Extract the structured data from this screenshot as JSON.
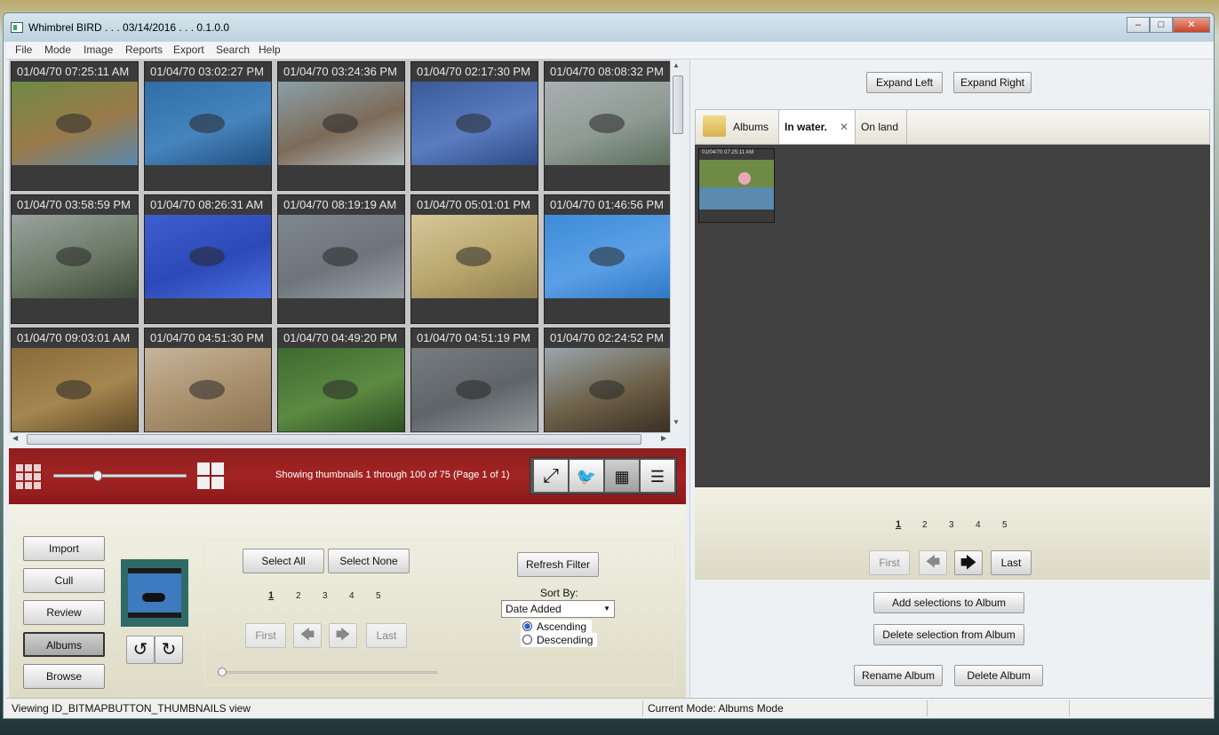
{
  "window": {
    "title": "Whimbrel BIRD . . . 03/14/2016 . . . 0.1.0.0"
  },
  "menu": [
    "File",
    "Mode",
    "Image",
    "Reports",
    "Export",
    "Search",
    "Help"
  ],
  "thumbnails": [
    {
      "ts": "01/04/70 07:25:11 AM",
      "colors": [
        "#6f8a45",
        "#9a7a4a",
        "#5a8ab0"
      ]
    },
    {
      "ts": "01/04/70 03:02:27 PM",
      "colors": [
        "#2f6ea8",
        "#4684bd",
        "#1f4f80"
      ]
    },
    {
      "ts": "01/04/70 03:24:36 PM",
      "colors": [
        "#8aa0a8",
        "#7c6a58",
        "#b8c0c2"
      ]
    },
    {
      "ts": "01/04/70 02:17:30 PM",
      "colors": [
        "#3a5a9a",
        "#5a7cbf",
        "#2e4a86"
      ]
    },
    {
      "ts": "01/04/70 08:08:32 PM",
      "colors": [
        "#a8b0b0",
        "#8e9a94",
        "#5b6e5a"
      ]
    },
    {
      "ts": "01/04/70 03:58:59 PM",
      "colors": [
        "#9aa3a0",
        "#6c7a66",
        "#3d4a3a"
      ]
    },
    {
      "ts": "01/04/70 08:26:31 AM",
      "colors": [
        "#3e5fd1",
        "#2c49b8",
        "#4a6ee0"
      ]
    },
    {
      "ts": "01/04/70 08:19:19 AM",
      "colors": [
        "#7f8790",
        "#6d747c",
        "#9ba2a8"
      ]
    },
    {
      "ts": "01/04/70 05:01:01 PM",
      "colors": [
        "#d6c79a",
        "#b9a66d",
        "#8f7f50"
      ]
    },
    {
      "ts": "01/04/70 01:46:56 PM",
      "colors": [
        "#3e8bd8",
        "#5aa0e6",
        "#2e78c6"
      ]
    },
    {
      "ts": "01/04/70 09:03:01 AM",
      "colors": [
        "#8a6a3a",
        "#a5864f",
        "#5f4a26"
      ]
    },
    {
      "ts": "01/04/70 04:51:30 PM",
      "colors": [
        "#c6b49a",
        "#a88f6c",
        "#8a7352"
      ]
    },
    {
      "ts": "01/04/70 04:49:20 PM",
      "colors": [
        "#3f6a30",
        "#5c8a42",
        "#2d4f22"
      ]
    },
    {
      "ts": "01/04/70 04:51:19 PM",
      "colors": [
        "#777c80",
        "#5f6468",
        "#92979a"
      ]
    },
    {
      "ts": "01/04/70 02:24:52 PM",
      "colors": [
        "#9aa6ae",
        "#6c6048",
        "#3a3024"
      ]
    }
  ],
  "toolbar": {
    "showing": "Showing thumbnails 1 through 100 of 75 (Page 1 of 1)"
  },
  "modes": [
    "Import",
    "Cull",
    "Review",
    "Albums",
    "Browse"
  ],
  "active_mode": "Albums",
  "selection": {
    "select_all": "Select All",
    "select_none": "Select None",
    "refresh": "Refresh Filter"
  },
  "pager": {
    "pages": [
      "1",
      "2",
      "3",
      "4",
      "5"
    ],
    "first": "First",
    "last": "Last"
  },
  "sort": {
    "label": "Sort By:",
    "selected": "Date Added",
    "ascending": "Ascending",
    "descending": "Descending"
  },
  "right": {
    "expand_left": "Expand Left",
    "expand_right": "Expand Right",
    "tabs": {
      "albums": "Albums",
      "in_water": "In water.",
      "on_land": "On land"
    },
    "album_thumb_ts": "01/04/70 07:25:11 AM",
    "pages": [
      "1",
      "2",
      "3",
      "4",
      "5"
    ],
    "first": "First",
    "last": "Last",
    "add": "Add selections to Album",
    "delete_sel": "Delete selection from Album",
    "rename": "Rename Album",
    "delete_album": "Delete Album"
  },
  "status": {
    "left": "Viewing ID_BITMAPBUTTON_THUMBNAILS view",
    "mode": "Current Mode: Albums Mode"
  }
}
